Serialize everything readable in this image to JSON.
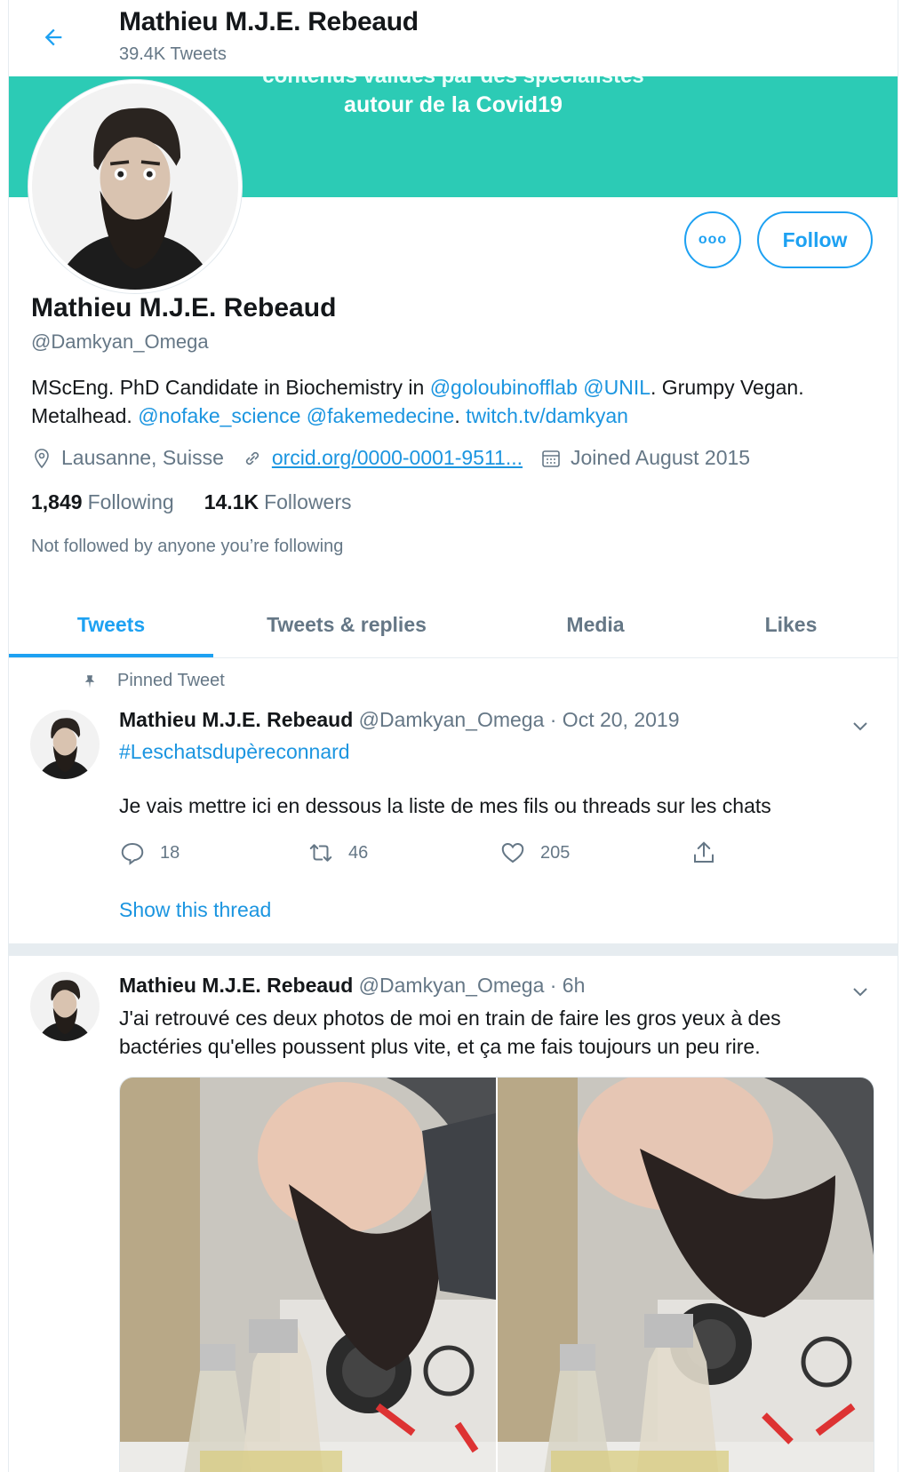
{
  "header": {
    "title": "Mathieu M.J.E. Rebeaud",
    "tweet_count": "39.4K Tweets"
  },
  "banner": {
    "line1": "contenus validés par des spécialistes",
    "line2": "autour de la Covid19"
  },
  "actions": {
    "more_label": "ooo",
    "follow_label": "Follow"
  },
  "profile": {
    "name": "Mathieu M.J.E. Rebeaud",
    "handle": "@Damkyan_Omega",
    "bio": {
      "t1": "MScEng. PhD Candidate in Biochemistry in ",
      "link1": "@goloubinofflab",
      "t2": " ",
      "link2": "@UNIL",
      "t3": ". Grumpy Vegan.",
      "t4": "Metalhead. ",
      "link3": "@nofake_science",
      "t5": " ",
      "link4": "@fakemedecine",
      "t6": ". ",
      "link5": "twitch.tv/damkyan"
    },
    "location": "Lausanne, Suisse",
    "url": "orcid.org/0000-0001-9511...",
    "joined": "Joined August 2015",
    "following_count": "1,849",
    "following_label": "Following",
    "followers_count": "14.1K",
    "followers_label": "Followers",
    "not_followed": "Not followed by anyone you’re following"
  },
  "tabs": [
    {
      "label": "Tweets"
    },
    {
      "label": "Tweets & replies"
    },
    {
      "label": "Media"
    },
    {
      "label": "Likes"
    }
  ],
  "tweets": [
    {
      "pinned_label": "Pinned Tweet",
      "name": "Mathieu M.J.E. Rebeaud",
      "handle_time": "@Damkyan_Omega · Oct 20, 2019",
      "hashtag": "#Leschatsdupèreconnard",
      "text": "Je vais mettre ici en dessous la liste de mes fils ou threads sur les chats",
      "replies": "18",
      "retweets": "46",
      "likes": "205",
      "show_thread": "Show this thread"
    },
    {
      "name": "Mathieu M.J.E. Rebeaud",
      "handle_time": "@Damkyan_Omega · 6h",
      "text": "J'ai retrouvé ces deux photos de moi en train de faire les gros yeux à des bactéries qu'elles poussent plus vite, et ça me fais toujours un peu rire."
    }
  ],
  "icons": {
    "back": "arrow-left-icon",
    "location": "location-pin-icon",
    "link": "link-icon",
    "calendar": "calendar-icon",
    "pin": "pin-icon",
    "reply": "reply-icon",
    "retweet": "retweet-icon",
    "like": "heart-icon",
    "share": "share-icon",
    "chevron": "chevron-down-icon"
  },
  "colors": {
    "accent": "#1da1f2",
    "banner": "#2ccbb5",
    "secondary_text": "#657786"
  }
}
